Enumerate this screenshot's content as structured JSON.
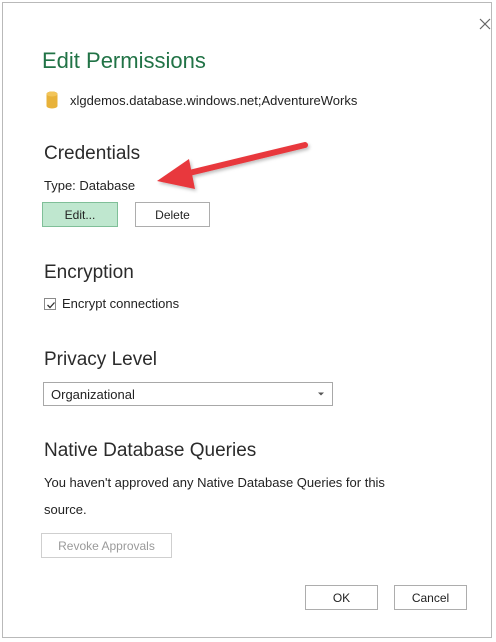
{
  "dialog": {
    "title": "Edit Permissions",
    "source": "xlgdemos.database.windows.net;AdventureWorks",
    "source_icon": "database-icon",
    "close_icon": "close-icon"
  },
  "credentials": {
    "heading": "Credentials",
    "type_label": "Type: Database",
    "edit_label": "Edit...",
    "delete_label": "Delete"
  },
  "encryption": {
    "heading": "Encryption",
    "checkbox_label": "Encrypt connections",
    "checked": true
  },
  "privacy": {
    "heading": "Privacy Level",
    "selected": "Organizational"
  },
  "native_queries": {
    "heading": "Native Database Queries",
    "message_line1": "You haven't approved any Native Database Queries for this",
    "message_line2": "source.",
    "revoke_label": "Revoke Approvals"
  },
  "footer": {
    "ok_label": "OK",
    "cancel_label": "Cancel"
  },
  "colors": {
    "title": "#217346",
    "edit_button_bg": "#bfe7cf",
    "annotation_arrow": "#e8383d",
    "db_icon": "#e8b23a"
  }
}
